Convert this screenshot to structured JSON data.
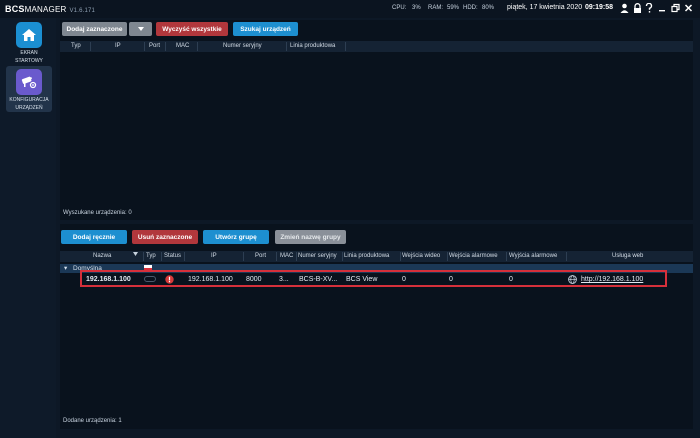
{
  "app": {
    "brand": "BCS",
    "product": "MANAGER",
    "version": "V1.6.171"
  },
  "system": {
    "cpu_label": "CPU:",
    "cpu_value": "3%",
    "ram_label": "RAM:",
    "ram_value": "59%",
    "hdd_label": "HDD:",
    "hdd_value": "80%",
    "date": "piątek, 17 kwietnia 2020",
    "time": "09:19:58"
  },
  "sidebar": {
    "items": [
      {
        "label_line1": "EKRAN",
        "label_line2": "STARTOWY",
        "icon": "home-icon"
      },
      {
        "label_line1": "KONFIGURACJA",
        "label_line2": "URZĄDZEŃ",
        "icon": "device-config-icon"
      }
    ]
  },
  "search_panel": {
    "buttons": {
      "add_selected": "Dodaj zaznaczone",
      "clear_all": "Wyczyść wszystkie",
      "search": "Szukaj urządzeń"
    },
    "columns": [
      "Typ",
      "IP",
      "Port",
      "MAC",
      "Numer seryjny",
      "Linia produktowa"
    ],
    "status_label": "Wyszukane urządzenia:",
    "status_count": "0"
  },
  "device_panel": {
    "buttons": {
      "add_manual": "Dodaj ręcznie",
      "delete_selected": "Usuń zaznaczone",
      "create_group": "Utwórz grupę",
      "rename_group": "Zmień nazwę grupy"
    },
    "columns": [
      "Nazwa",
      "Typ",
      "Status",
      "IP",
      "Port",
      "MAC",
      "Numer seryjny",
      "Linia produktowa",
      "Wejścia wideo",
      "Wejścia alarmowe",
      "Wyjścia alarmowe",
      "Usługa web"
    ],
    "group": {
      "name": "Domyślna"
    },
    "device": {
      "name": "192.168.1.100",
      "ip": "192.168.1.100",
      "port": "8000",
      "mac": "3...",
      "serial": "BCS-B-XV...",
      "product_line": "BCS View",
      "video_inputs": "0",
      "alarm_inputs": "0",
      "alarm_outputs": "0",
      "web_service": "http://192.168.1.100"
    },
    "status_label": "Dodane urządzenia:",
    "status_count": "1"
  },
  "colors": {
    "background": "#0d1826",
    "accent_blue": "#1d8fd0",
    "danger_red": "#b1373c",
    "highlight_border": "#d6303b",
    "group_row": "#1b3856"
  }
}
